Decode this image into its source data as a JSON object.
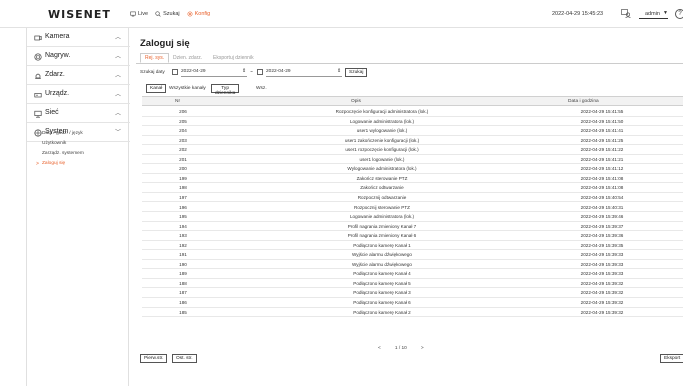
{
  "header": {
    "logo": "WISENET",
    "nav": [
      {
        "label": "Live",
        "icon": "monitor-icon"
      },
      {
        "label": "Szukaj",
        "icon": "search-icon"
      },
      {
        "label": "Konfig",
        "icon": "gear-icon"
      }
    ],
    "datetime": "2022-04-29 15:45:23",
    "user": "admin",
    "help": "?"
  },
  "sidebar": {
    "items": [
      {
        "label": "Kamera",
        "icon": "camera-icon",
        "chevron": "^"
      },
      {
        "label": "Nagryw.",
        "icon": "record-icon",
        "chevron": "^"
      },
      {
        "label": "Zdarz.",
        "icon": "bell-icon",
        "chevron": "^"
      },
      {
        "label": "Urządz.",
        "icon": "device-icon",
        "chevron": "^"
      },
      {
        "label": "Sieć",
        "icon": "network-icon",
        "chevron": "^"
      },
      {
        "label": "System",
        "icon": "system-icon",
        "chevron": "v"
      }
    ],
    "sub_items": [
      "Data / godz. / język",
      "Użytkownik",
      "Zarządz. systemem",
      "Zaloguj się"
    ],
    "active_sub_arrow": ">"
  },
  "main": {
    "title": "Zaloguj się",
    "tabs": [
      "Rej. sys.",
      "Dzien. zdarz.",
      "Eksportuj dziennik"
    ],
    "search": {
      "label": "Szukaj daty",
      "from": "2022-04-29",
      "to_separator": "~",
      "to": "2022-04-29",
      "button": "Szukaj"
    },
    "filters": {
      "channel_btn": "Kanał",
      "channels_value": "Wszystkie kanały",
      "type_btn": "Typ dziennika",
      "type_value": "Wsz."
    },
    "table": {
      "headers": [
        "Nr",
        "Opis",
        "Data i godzina"
      ],
      "rows": [
        [
          "206",
          "Rozpoczęcie konfiguracji administratora (lok.)",
          "2022-04-29 15:41:55"
        ],
        [
          "205",
          "Logowanie administratora (lok.)",
          "2022-04-29 15:41:50"
        ],
        [
          "204",
          "user1 wylogowanie (lok.)",
          "2022-04-29 15:41:41"
        ],
        [
          "203",
          "user1 zakończenie konfiguracji (lok.)",
          "2022-04-29 15:41:25"
        ],
        [
          "202",
          "user1 rozpoczęcie konfiguracji (lok.)",
          "2022-04-29 15:41:22"
        ],
        [
          "201",
          "user1 logowanie (lok.)",
          "2022-04-29 15:41:21"
        ],
        [
          "200",
          "Wylogowanie administratora (lok.)",
          "2022-04-29 15:41:12"
        ],
        [
          "199",
          "Zakończ sterowanie PTZ",
          "2022-04-29 15:41:08"
        ],
        [
          "198",
          "Zakończ odtwarzanie",
          "2022-04-29 15:41:08"
        ],
        [
          "197",
          "Rozpocznij odtwarzanie",
          "2022-04-29 15:40:54"
        ],
        [
          "196",
          "Rozpocznij sterowanie PTZ",
          "2022-04-29 15:40:31"
        ],
        [
          "195",
          "Logowanie administratora (lok.)",
          "2022-04-29 15:39:46"
        ],
        [
          "194",
          "Profil nagrania zmieniony Kanał 7",
          "2022-04-29 15:39:37"
        ],
        [
          "193",
          "Profil nagrania zmieniony Kanał 6",
          "2022-04-29 15:39:36"
        ],
        [
          "192",
          "Podłączono kamerę Kanał 1",
          "2022-04-29 15:39:35"
        ],
        [
          "191",
          "Wyjście alarmu dźwiękowego",
          "2022-04-29 15:39:33"
        ],
        [
          "190",
          "Wyjście alarmu dźwiękowego",
          "2022-04-29 15:39:33"
        ],
        [
          "189",
          "Podłączono kamerę Kanał 4",
          "2022-04-29 15:39:33"
        ],
        [
          "188",
          "Podłączono kamerę Kanał 5",
          "2022-04-29 15:39:32"
        ],
        [
          "187",
          "Podłączono kamerę Kanał 3",
          "2022-04-29 15:39:32"
        ],
        [
          "186",
          "Podłączono kamerę Kanał 6",
          "2022-04-29 15:39:32"
        ],
        [
          "185",
          "Podłączono kamerę Kanał 2",
          "2022-04-29 15:39:32"
        ]
      ]
    },
    "pager": {
      "prev": "<",
      "page": "1 / 10",
      "next": ">"
    },
    "buttons": {
      "first": "Pierw.str.",
      "last": "Ost. str.",
      "export": "Eksport"
    }
  },
  "colors": {
    "accent": "#e8612c",
    "border": "#e0e0e0",
    "header_bg": "#f2f2f2"
  }
}
